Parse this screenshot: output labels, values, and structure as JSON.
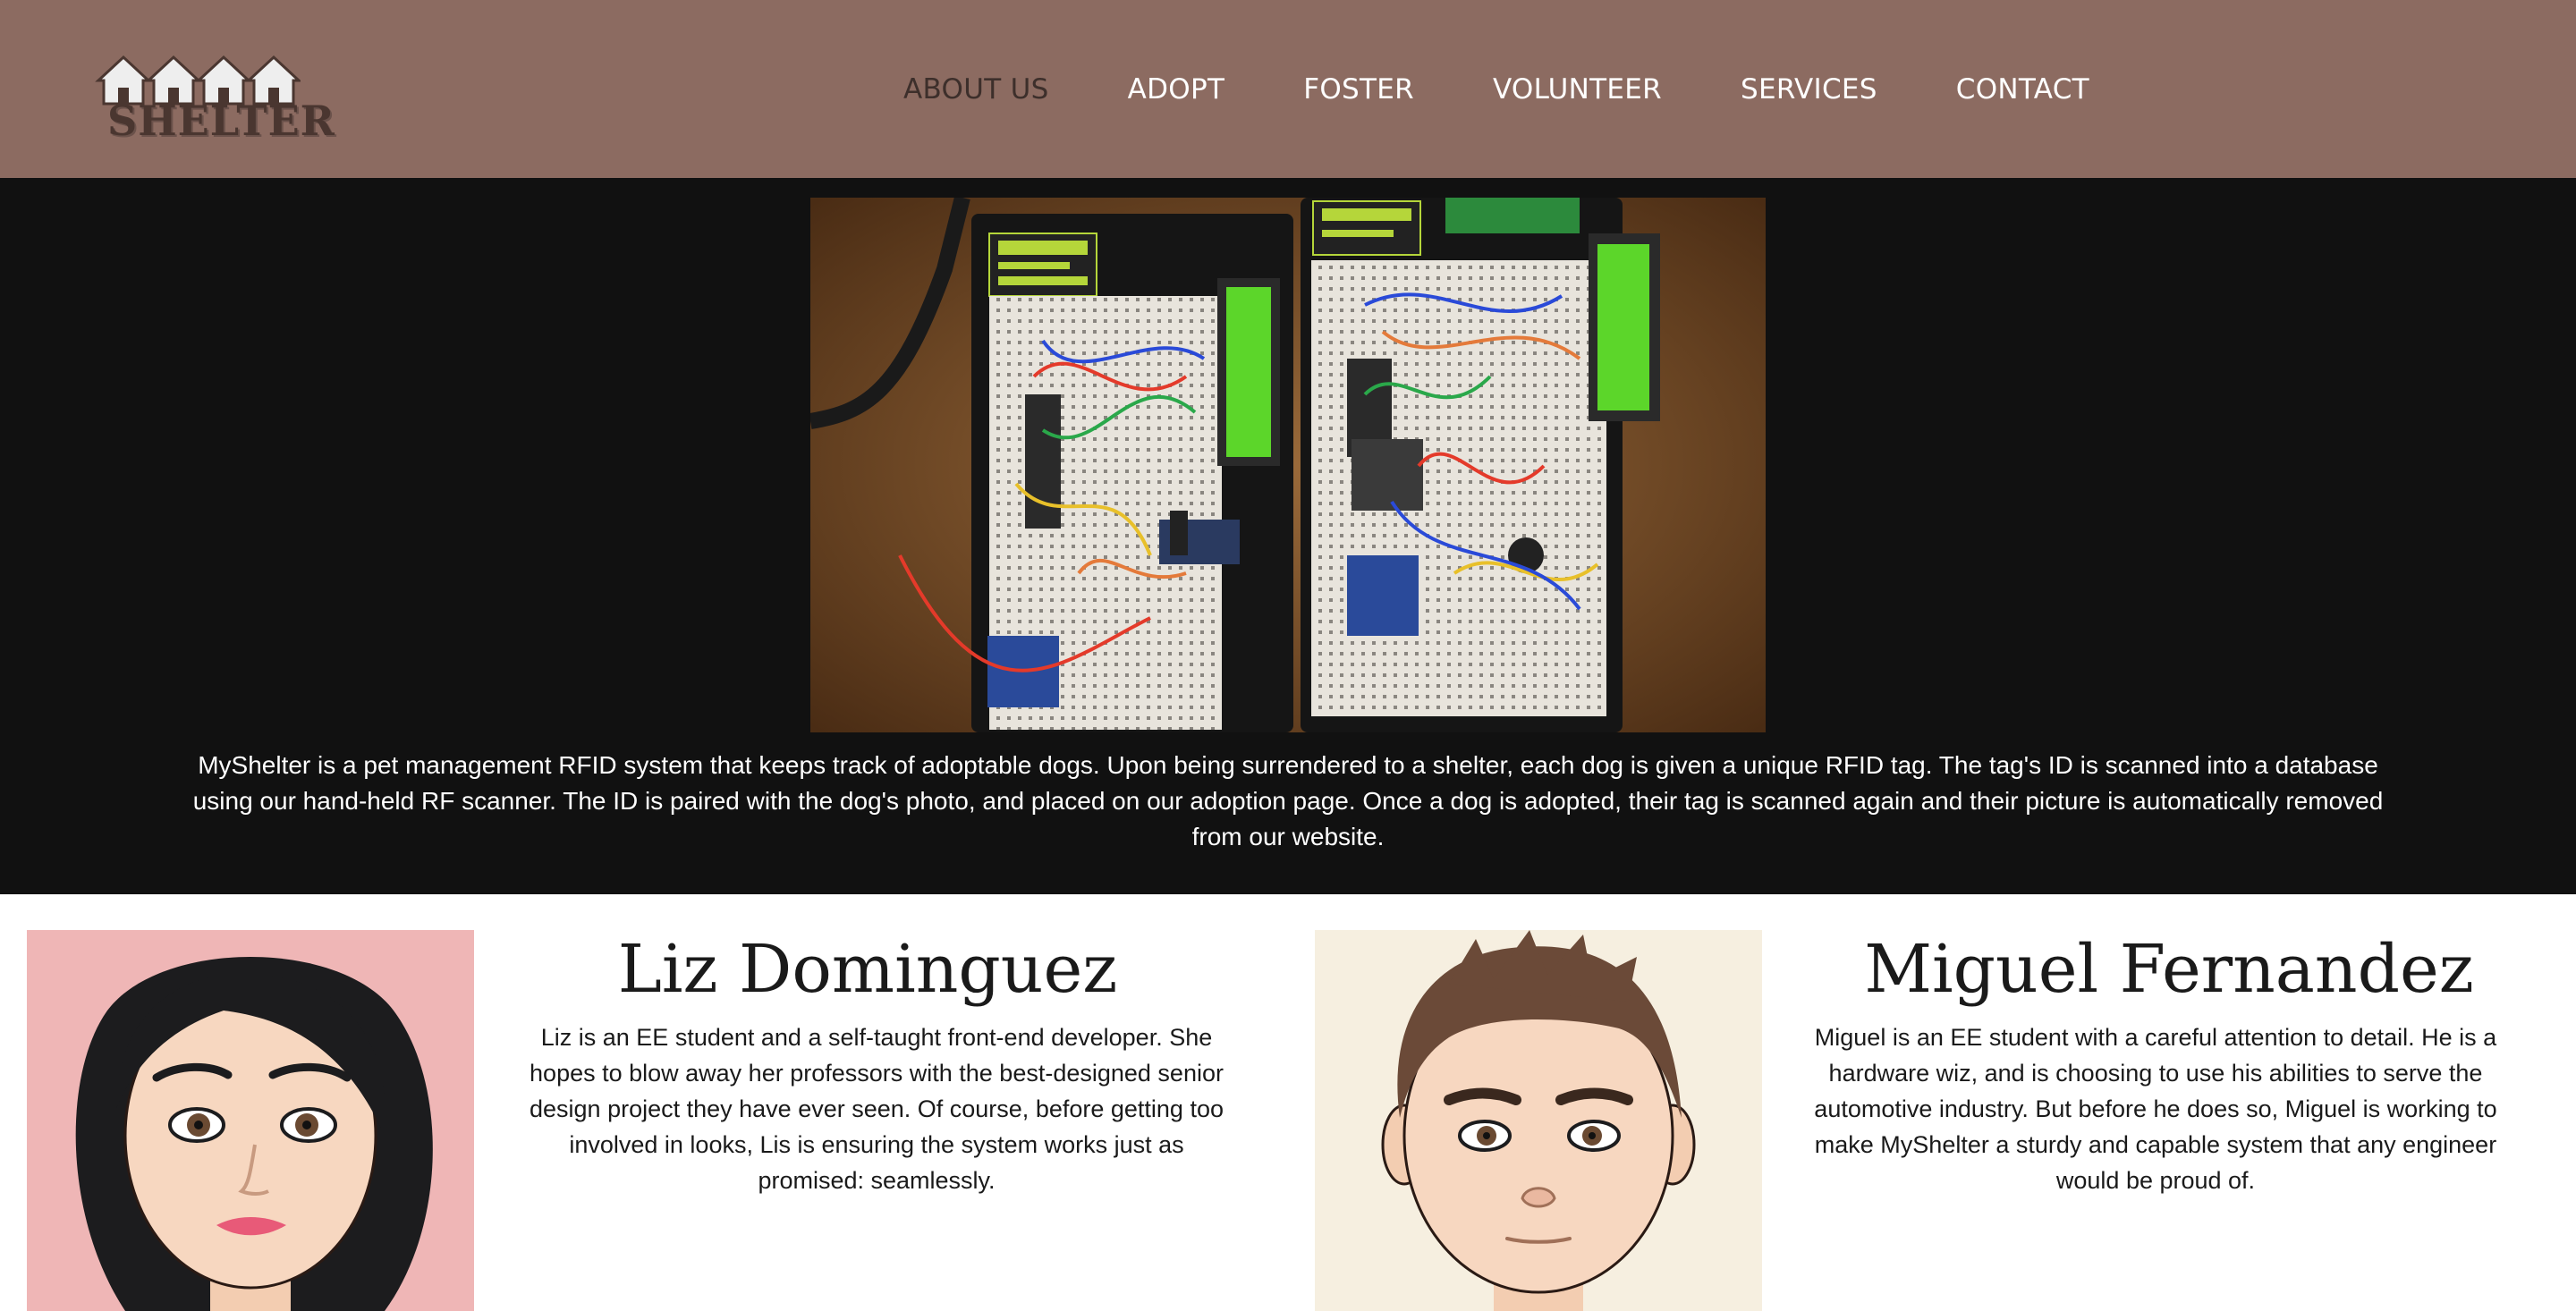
{
  "header": {
    "logo_text": "SHELTER",
    "nav": [
      {
        "label": "ABOUT US",
        "active": true
      },
      {
        "label": "ADOPT"
      },
      {
        "label": "FOSTER"
      },
      {
        "label": "VOLUNTEER"
      },
      {
        "label": "SERVICES"
      },
      {
        "label": "CONTACT"
      }
    ]
  },
  "hero": {
    "description": "MyShelter is a pet management RFID system that keeps track of adoptable dogs. Upon being surrendered to a shelter, each dog is given a unique RFID tag. The tag's ID is scanned into a database using our hand-held RF scanner. The ID is paired with the dog's photo, and placed on our adoption page. Once a dog is adopted, their tag is scanned again and their picture is automatically removed from our website."
  },
  "team": [
    {
      "name": "Liz Dominguez",
      "bio": "Liz is an EE student and a self-taught front-end developer. She hopes to blow away her professors with the best-designed senior design project they have ever seen. Of course, before getting too involved in looks, Lis is ensuring the system works just as promised: seamlessly."
    },
    {
      "name": "Miguel Fernandez",
      "bio": "Miguel is an EE student with a careful attention to detail. He is a hardware wiz, and is choosing to use his abilities to serve the automotive industry. But before he does so, Miguel is working to make MyShelter a sturdy and capable system that any engineer would be proud of."
    }
  ],
  "colors": {
    "header_bg": "#8c6b61",
    "hero_bg": "#111111",
    "nav_active": "#3d2f2b",
    "nav_text": "#ffffff"
  }
}
